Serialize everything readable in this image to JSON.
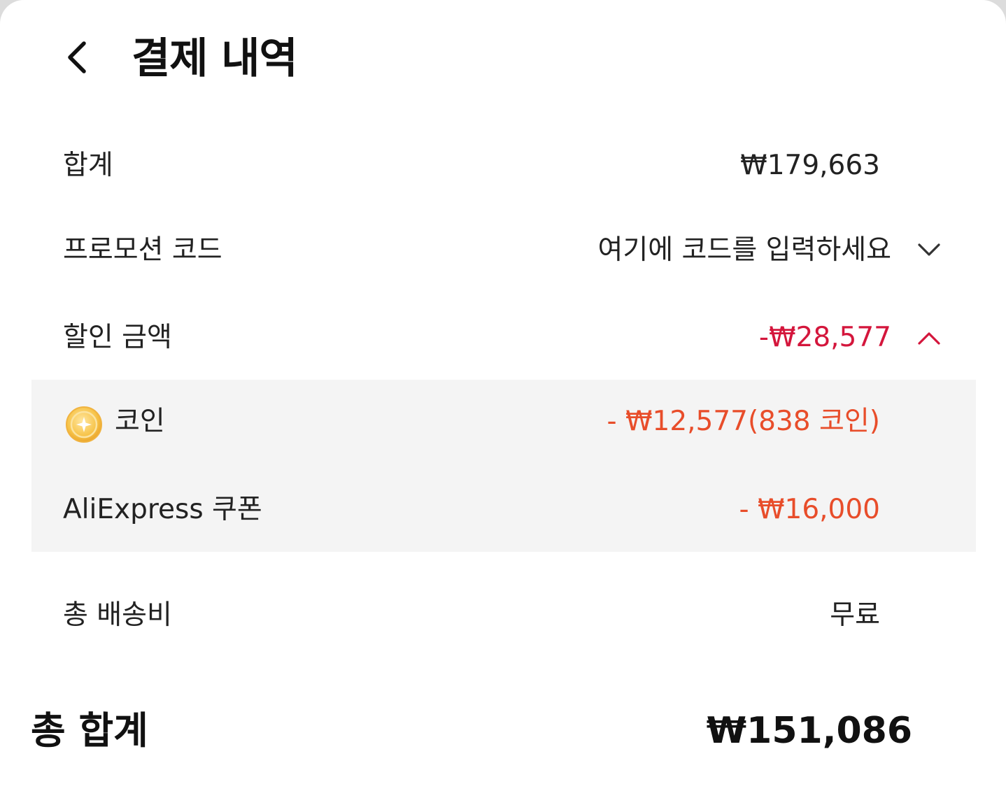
{
  "header": {
    "title": "결제 내역",
    "back_icon": "chevron-left-icon"
  },
  "rows": {
    "subtotal": {
      "label": "합계",
      "value": "₩179,663"
    },
    "promo": {
      "label": "프로모션 코드",
      "placeholder": "여기에 코드를 입력하세요",
      "icon": "chevron-down-icon"
    },
    "discount": {
      "label": "할인 금액",
      "value": "-₩28,577",
      "icon": "chevron-up-icon"
    },
    "coin": {
      "label": "코인",
      "value": "- ₩12,577(838 코인)",
      "icon": "coin-icon"
    },
    "coupon": {
      "label": "AliExpress 쿠폰",
      "value": "- ₩16,000"
    },
    "shipping": {
      "label": "총 배송비",
      "value": "무료"
    }
  },
  "total": {
    "label": "총 합계",
    "value": "₩151,086"
  },
  "colors": {
    "discount_total": "#d4163c",
    "discount_detail": "#e84d2a",
    "panel_bg": "#f4f4f4",
    "coin": "#f7c44a"
  }
}
